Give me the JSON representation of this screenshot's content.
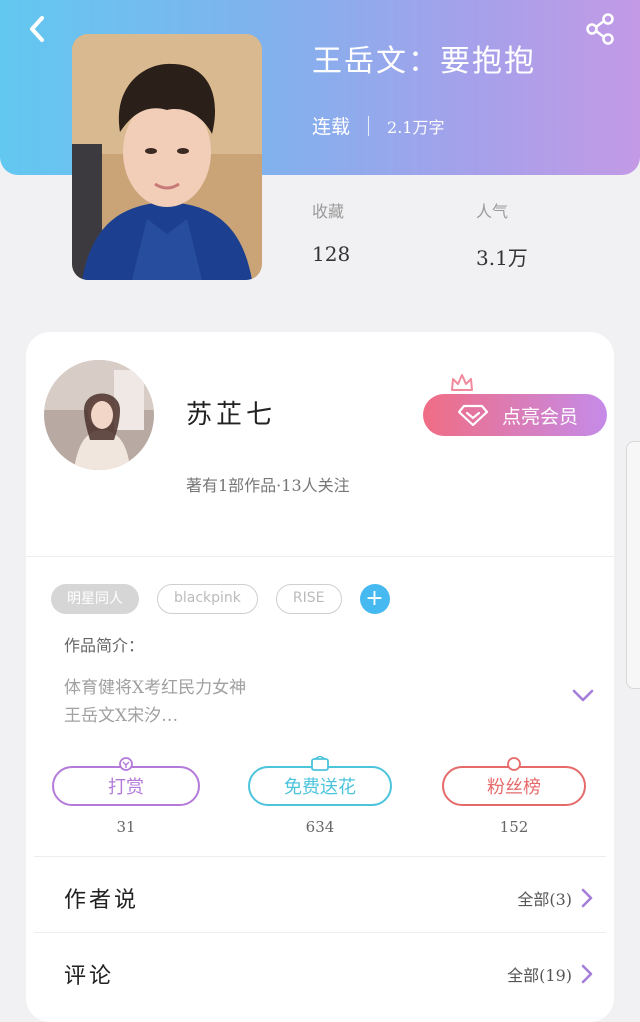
{
  "header": {
    "title": "王岳文：要抱抱",
    "status": "连载",
    "views": "2.1万字",
    "colors": {
      "gradient_start": "#62c8f0",
      "gradient_end": "#c39ae6"
    }
  },
  "icons": {
    "back": "chevron-left-icon",
    "share": "share-icon"
  },
  "stats": [
    {
      "label": "收藏",
      "value": "128"
    },
    {
      "label": "人气",
      "value": "3.1万"
    }
  ],
  "author": {
    "name": "苏芷七",
    "info": "著有1部作品·13人关注",
    "vip_label": "点亮会员"
  },
  "tags": [
    {
      "label": "明星同人",
      "active": true
    },
    {
      "label": "blackpink",
      "active": false
    },
    {
      "label": "RISE",
      "active": false
    }
  ],
  "intro": {
    "label": "作品简介：",
    "line1": "体育健将X考红民力女神",
    "line2": "王岳文X宋汐…"
  },
  "actions": [
    {
      "label": "打赏",
      "count": "31",
      "color": "#b47ad9"
    },
    {
      "label": "免费送花",
      "count": "634",
      "color": "#4cc4dc"
    },
    {
      "label": "粉丝榜",
      "count": "152",
      "color": "#e66a6a"
    }
  ],
  "rows": [
    {
      "label": "作者说",
      "value": "全部(3)"
    },
    {
      "label": "评论",
      "value": "全部(19)"
    }
  ]
}
